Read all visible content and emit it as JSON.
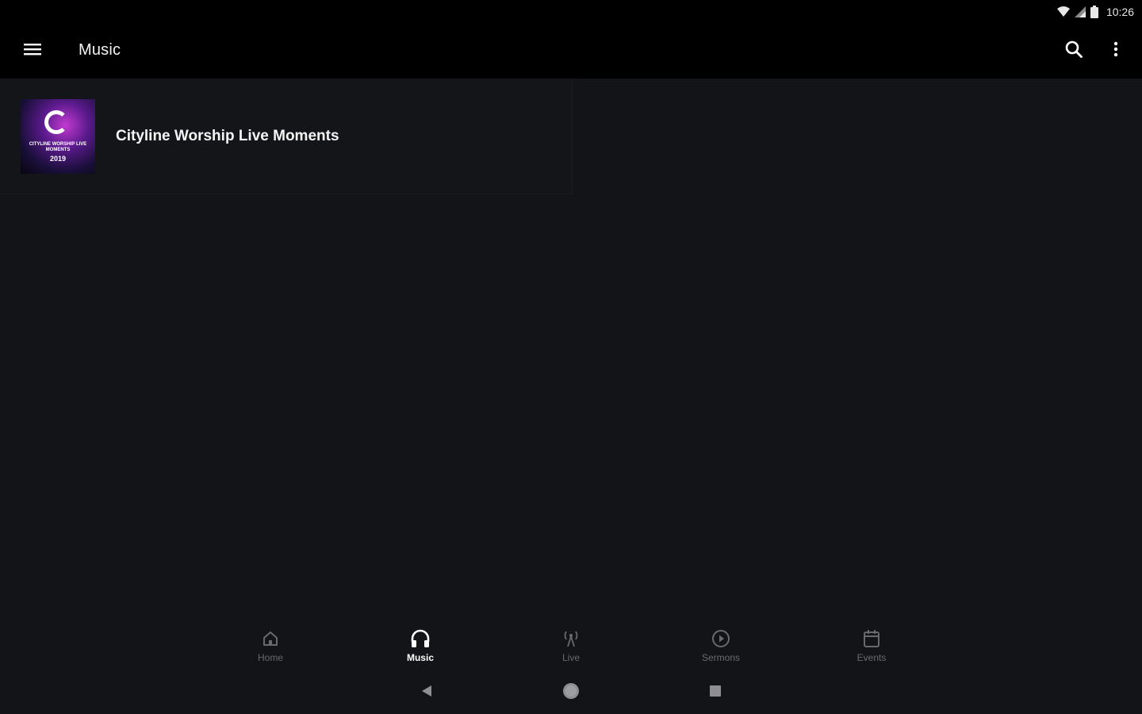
{
  "status_bar": {
    "time": "10:26",
    "icons": [
      "wifi-icon",
      "signal-icon",
      "battery-icon"
    ]
  },
  "app_bar": {
    "title": "Music",
    "icons": [
      "menu-icon",
      "search-icon",
      "more-vert-icon"
    ]
  },
  "albums": [
    {
      "title": "Cityline Worship Live Moments",
      "art_text": "CITYLINE WORSHIP LIVE MOMENTS",
      "art_year": "2019"
    }
  ],
  "bottom_nav": {
    "items": [
      {
        "label": "Home",
        "icon": "home-icon",
        "active": false
      },
      {
        "label": "Music",
        "icon": "headphones-icon",
        "active": true
      },
      {
        "label": "Live",
        "icon": "antenna-icon",
        "active": false
      },
      {
        "label": "Sermons",
        "icon": "play-circle-icon",
        "active": false
      },
      {
        "label": "Events",
        "icon": "calendar-icon",
        "active": false
      }
    ]
  },
  "system_nav": {
    "icons": [
      "back-icon",
      "home-circle-icon",
      "recents-icon"
    ]
  },
  "colors": {
    "background": "#131417",
    "bar": "#000000",
    "active": "#ffffff",
    "inactive": "#6a6a6e"
  }
}
